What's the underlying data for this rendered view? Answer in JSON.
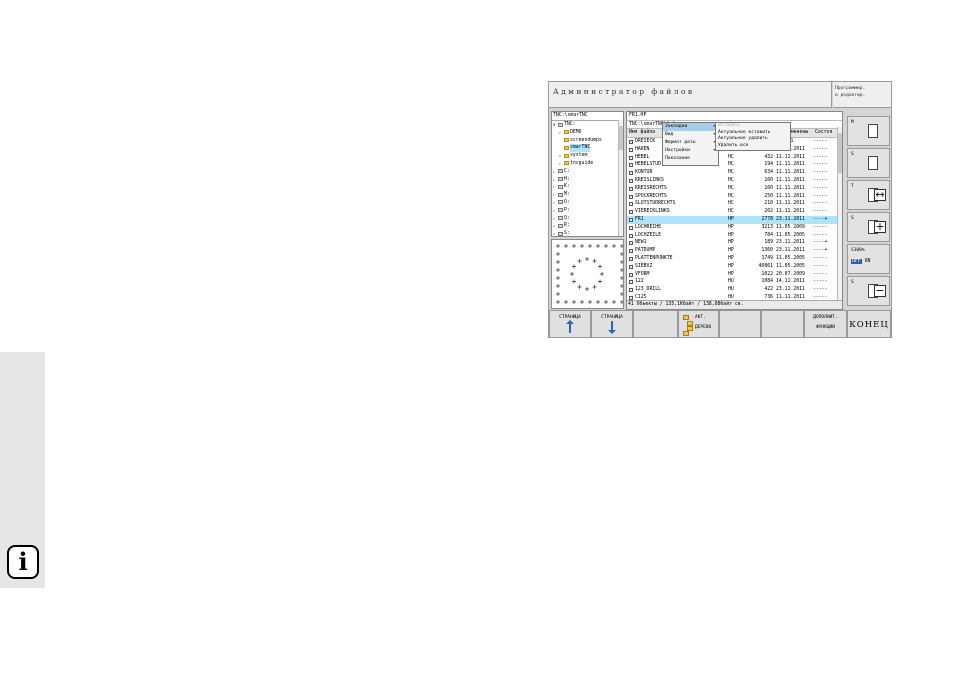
{
  "page": {
    "info_glyph": "i"
  },
  "screen": {
    "title": "Администратор файлов",
    "mode": [
      "Программир.",
      "и редактир."
    ]
  },
  "tree": {
    "path": "TNC:\\smarTNC",
    "items": [
      {
        "label": "TNC:",
        "level": 0,
        "expander": "▼",
        "type": "drive",
        "selected": false
      },
      {
        "label": "DEMO",
        "level": 1,
        "expander": "▸",
        "type": "folder",
        "selected": false
      },
      {
        "label": "screendumps",
        "level": 1,
        "expander": "",
        "type": "folder",
        "selected": false
      },
      {
        "label": "smarTNC",
        "level": 1,
        "expander": "",
        "type": "folder",
        "selected": true
      },
      {
        "label": "system",
        "level": 1,
        "expander": "▸",
        "type": "folder",
        "selected": false
      },
      {
        "label": "tncguide",
        "level": 1,
        "expander": "▸",
        "type": "folder",
        "selected": false
      },
      {
        "label": "C:",
        "level": 0,
        "expander": "▸",
        "type": "drive",
        "selected": false
      },
      {
        "label": "H:",
        "level": 0,
        "expander": "▸",
        "type": "drive",
        "selected": false
      },
      {
        "label": "K:",
        "level": 0,
        "expander": "▸",
        "type": "drive",
        "selected": false
      },
      {
        "label": "M:",
        "level": 0,
        "expander": "▸",
        "type": "drive",
        "selected": false
      },
      {
        "label": "O:",
        "level": 0,
        "expander": "▸",
        "type": "drive",
        "selected": false
      },
      {
        "label": "P:",
        "level": 0,
        "expander": "▸",
        "type": "drive",
        "selected": false
      },
      {
        "label": "Q:",
        "level": 0,
        "expander": "▸",
        "type": "drive",
        "selected": false
      },
      {
        "label": "R:",
        "level": 0,
        "expander": "▸",
        "type": "drive",
        "selected": false
      },
      {
        "label": "S:",
        "level": 0,
        "expander": "▸",
        "type": "drive",
        "selected": false
      }
    ]
  },
  "files": {
    "current": "FR1.HP",
    "path": "TNC:\\smarTNC\\*.*",
    "columns": [
      "Имя файла",
      "Тип",
      "Размер",
      "Изменены",
      "Состоя"
    ],
    "rows": [
      {
        "name": "DREIECK",
        "type": "HC",
        "size": "",
        "date": "1.2011",
        "status": "-----",
        "selected": false
      },
      {
        "name": "HAKEN",
        "type": "HC",
        "size": "602",
        "date": "14.11.2011",
        "status": "-----",
        "selected": false
      },
      {
        "name": "HEBEL",
        "type": "HC",
        "size": "432",
        "date": "11.11.2011",
        "status": "-----",
        "selected": false
      },
      {
        "name": "HEBELSTUD",
        "type": "HC",
        "size": "194",
        "date": "11.11.2011",
        "status": "-----",
        "selected": false
      },
      {
        "name": "KONTUR",
        "type": "HC",
        "size": "634",
        "date": "11.11.2011",
        "status": "-----",
        "selected": false
      },
      {
        "name": "KREISLINKS",
        "type": "HC",
        "size": "160",
        "date": "11.11.2011",
        "status": "-----",
        "selected": false
      },
      {
        "name": "KREISRECHTS",
        "type": "HC",
        "size": "160",
        "date": "11.11.2011",
        "status": "-----",
        "selected": false
      },
      {
        "name": "SPOCKRECHTS",
        "type": "HC",
        "size": "250",
        "date": "11.11.2011",
        "status": "-----",
        "selected": false
      },
      {
        "name": "SLOTSTUDRECHTS",
        "type": "HC",
        "size": "210",
        "date": "11.11.2011",
        "status": "-----",
        "selected": false
      },
      {
        "name": "VIERECKLINKS",
        "type": "HC",
        "size": "202",
        "date": "11.11.2011",
        "status": "-----",
        "selected": false
      },
      {
        "name": "FR1",
        "type": "HP",
        "size": "2778",
        "date": "23.11.2011",
        "status": "----+",
        "selected": true
      },
      {
        "name": "LOCHREIHE",
        "type": "HP",
        "size": "3213",
        "date": "11.05.2009",
        "status": "-----",
        "selected": false
      },
      {
        "name": "LOCHZEILE",
        "type": "HP",
        "size": "784",
        "date": "11.05.2005",
        "status": "-----",
        "selected": false
      },
      {
        "name": "NEW1",
        "type": "HP",
        "size": "189",
        "date": "23.11.2011",
        "status": "----+",
        "selected": false
      },
      {
        "name": "PATDUMP",
        "type": "HP",
        "size": "1360",
        "date": "23.11.2011",
        "status": "----+",
        "selected": false
      },
      {
        "name": "PLATTENPUNKTE",
        "type": "HP",
        "size": "1749",
        "date": "11.05.2005",
        "status": "-----",
        "selected": false
      },
      {
        "name": "SIEBVZ",
        "type": "HP",
        "size": "40861",
        "date": "11.05.2005",
        "status": "-----",
        "selected": false
      },
      {
        "name": "VFORM",
        "type": "HP",
        "size": "1022",
        "date": "20.07.2009",
        "status": "-----",
        "selected": false
      },
      {
        "name": "122",
        "type": "HU",
        "size": "1084",
        "date": "14.11.2011",
        "status": "-----",
        "selected": false
      },
      {
        "name": "123_DRILL",
        "type": "HU",
        "size": "422",
        "date": "23.11.2011",
        "status": "-----",
        "selected": false
      },
      {
        "name": "C125",
        "type": "HU",
        "size": "736",
        "date": "11.11.2011",
        "status": "-----",
        "selected": false
      }
    ],
    "status_bar": "41 Объекты / 135,1Кбайт / 138,08байт св."
  },
  "context_menu": {
    "items": [
      {
        "label": "Закладки",
        "arrow": "▸",
        "highlight": true
      },
      {
        "label": "Вид",
        "arrow": "▸",
        "highlight": false
      },
      {
        "label": "Формат даты",
        "arrow": "▸",
        "highlight": false
      },
      {
        "label": "Настройки",
        "arrow": "▸",
        "highlight": false
      },
      {
        "label": "Показание",
        "arrow": "",
        "highlight": false
      }
    ],
    "submenu": [
      {
        "label": "Вставить",
        "disabled": true
      },
      {
        "label": "Актуальное вставить",
        "disabled": false
      },
      {
        "label": "Актуальное удалить",
        "disabled": false
      },
      {
        "label": "Удалить все",
        "disabled": false
      }
    ]
  },
  "side_panel": {
    "buttons": [
      {
        "tag": "M",
        "symbol": ""
      },
      {
        "tag": "S",
        "symbol": ""
      },
      {
        "tag": "T",
        "symbol": "↔"
      },
      {
        "tag": "S",
        "symbol": "+"
      },
      {
        "tag": "S100%",
        "symbol": "",
        "off": "OFF",
        "on": "ON"
      },
      {
        "tag": "S",
        "symbol": "−"
      }
    ]
  },
  "softkeys": [
    {
      "label": "СТРАНИЦА",
      "arrow": "up"
    },
    {
      "label": "СТРАНИЦА",
      "arrow": "down"
    },
    {
      "label": "",
      "arrow": ""
    },
    {
      "label": "АКТ.",
      "label2": "ДЕРЕВО",
      "arrow": "tree"
    },
    {
      "label": "",
      "arrow": ""
    },
    {
      "label": "",
      "arrow": ""
    },
    {
      "label": "ДОПОЛНИТ.",
      "label2": "ФУНКЦИИ",
      "arrow": ""
    },
    {
      "label": "",
      "big": "КОНЕЦ",
      "arrow": ""
    }
  ],
  "colors": {
    "selection": "#aee4f8",
    "menu_highlight": "#a8cde8",
    "accent_blue": "#2a63c8"
  }
}
